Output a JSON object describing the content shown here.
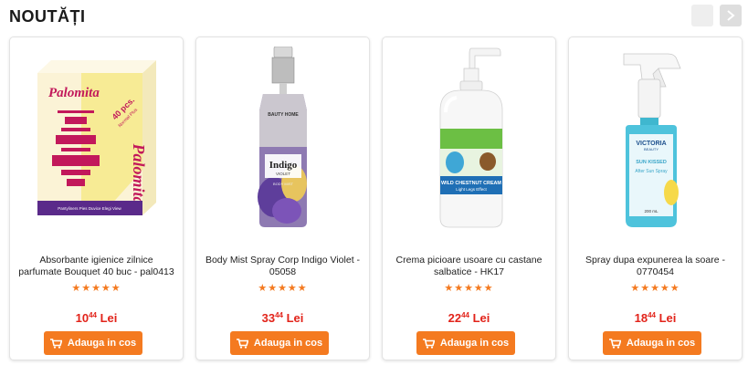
{
  "section": {
    "title": "NOUTĂȚI"
  },
  "products": [
    {
      "title": "Absorbante igienice zilnice parfumate Bouquet 40 buc - pal0413",
      "stars": "★★★★★",
      "price_int": "10",
      "price_dec": "44",
      "currency": "Lei",
      "button": "Adauga in cos",
      "package": {
        "brand": "Palomita",
        "badge_top": "40 pcs.",
        "badge_sub": "Normal Plus",
        "footer": "Pantyliners Pies Duvice Elegi View"
      }
    },
    {
      "title": "Body Mist Spray Corp Indigo Violet - 05058",
      "stars": "★★★★★",
      "price_int": "33",
      "price_dec": "44",
      "currency": "Lei",
      "button": "Adauga in cos",
      "package": {
        "brand": "BAUTY HOME",
        "label": "Indigo",
        "sub": "VIOLET",
        "type": "BODY MIST"
      }
    },
    {
      "title": "Crema picioare usoare cu castane salbatice - HK17",
      "stars": "★★★★★",
      "price_int": "22",
      "price_dec": "44",
      "currency": "Lei",
      "button": "Adauga in cos",
      "package": {
        "label": "WILD CHESTNUT CREAM",
        "sub": "Light Legs Effect"
      }
    },
    {
      "title": "Spray dupa expunerea la soare - 0770454",
      "stars": "★★★★★",
      "price_int": "18",
      "price_dec": "44",
      "currency": "Lei",
      "button": "Adauga in cos",
      "package": {
        "brand": "VICTORIA",
        "brand_sub": "BEAUTY",
        "label": "SUN KISSED",
        "sub": "After Sun Spray",
        "volume": "200 mL"
      }
    }
  ],
  "colors": {
    "accent": "#f47a20",
    "price": "#e2231a"
  }
}
